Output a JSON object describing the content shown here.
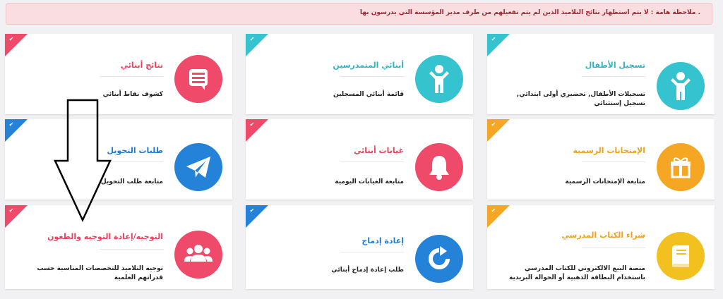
{
  "alert": {
    "text": ". ملاحظة هامة : لا يتم استظهار نتائج التلاميذ الذين لم يتم تفعيلهم من طرف مدير المؤسسة التي يدرسون بها"
  },
  "colors": {
    "cyan": "#35c3cf",
    "red": "#ef4a6a",
    "blue": "#2483d8",
    "orange": "#f5a623",
    "yellow": "#f2c01f"
  },
  "cards": [
    {
      "title": "تسجيل الأطفال",
      "desc": "تسجيلات الأطفال, تحضيري أولى ابتدائي, تسجيل إستثنائي",
      "icon": "child-icon"
    },
    {
      "title": "أبنائي المتمدرسين",
      "desc": "قائمة أبنائي المسجلين",
      "icon": "child-icon"
    },
    {
      "title": "نتائج أبنائي",
      "desc": "كشوف نقاط أبنائي",
      "icon": "message-list-icon"
    },
    {
      "title": "الإمتحانات الرسمية",
      "desc": "متابعة الإمتحانات الرسمية",
      "icon": "gift-icon"
    },
    {
      "title": "غيابات أبنائي",
      "desc": "متابعة الغيابات اليومية",
      "icon": "bell-icon"
    },
    {
      "title": "طلبات التحويل",
      "desc": "متابعة طلب التحويل",
      "icon": "paper-plane-icon"
    },
    {
      "title": "شراء الكتاب المدرسي",
      "desc": "منصة البيع الالكتروني للكتاب المدرسي باستخدام البطاقة الذهبية أو الحوالة البريدية",
      "icon": "book-icon"
    },
    {
      "title": "إعادة إدماج",
      "desc": "طلب إعادة إدماج أبنائي",
      "icon": "refresh-icon"
    },
    {
      "title": "التوجيه/إعادة التوجيه والطعون",
      "desc": "توجيه التلاميذ للتخصصات المناسبة حسب قدراتهم العلمية",
      "icon": "users-group-icon"
    }
  ]
}
